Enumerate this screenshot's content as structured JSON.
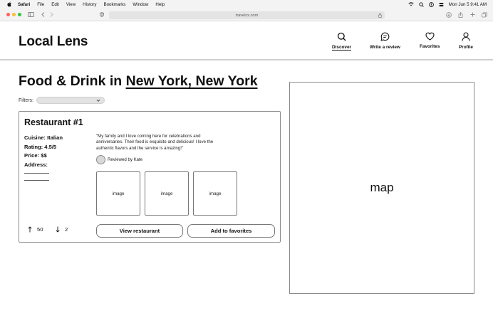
{
  "menubar": {
    "items": [
      "Safari",
      "File",
      "Edit",
      "View",
      "History",
      "Bookmarks",
      "Window",
      "Help"
    ],
    "clock": "Mon Jun 5  9:41 AM"
  },
  "browser": {
    "url": "travelcs.com"
  },
  "app": {
    "logo": "Local Lens",
    "nav": [
      {
        "label": "Discover",
        "icon": "search-icon",
        "active": true
      },
      {
        "label": "Write a review",
        "icon": "chat-icon",
        "active": false
      },
      {
        "label": "Favorites",
        "icon": "heart-icon",
        "active": false
      },
      {
        "label": "Profile",
        "icon": "person-icon",
        "active": false
      }
    ]
  },
  "page": {
    "title_prefix": "Food & Drink in ",
    "title_location": "New York, New York",
    "filters_label": "Filters:"
  },
  "restaurant": {
    "name": "Restaurant #1",
    "cuisine": "Cuisine: Italian",
    "rating": "Rating: 4.5/5",
    "price": "Price: $$",
    "address_label": "Address:",
    "review_text": "\"My family and I love coming here for celebrations and anniversaries. Their food is exquisite and delicious! I love the authentic flavors and the service is amazing!\"",
    "reviewer": "Reviewed by Kate",
    "images": [
      "image",
      "image",
      "image"
    ],
    "upvotes": "50",
    "downvotes": "2",
    "view_button": "View restaurant",
    "favorite_button": "Add to favorites"
  },
  "map": {
    "label": "map"
  },
  "colors": {
    "traffic_red": "#ff5f57",
    "traffic_yellow": "#febc2e",
    "traffic_green": "#28c840"
  }
}
